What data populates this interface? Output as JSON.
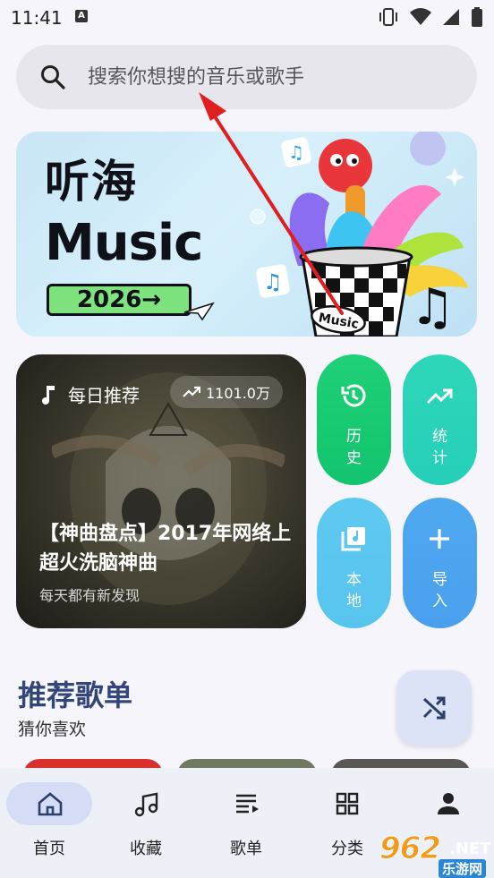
{
  "status_bar": {
    "time": "11:41",
    "notification_icon": "A"
  },
  "search": {
    "placeholder": "搜索你想搜的音乐或歌手"
  },
  "banner": {
    "title_cn": "听海",
    "title_en": "Music",
    "year_tag": "2026→",
    "bucket_label": "Music"
  },
  "daily": {
    "label": "每日推荐",
    "play_count": "1101.0万",
    "title": "【神曲盘点】2017年网络上超火洗脑神曲",
    "subtitle": "每天都有新发现"
  },
  "tiles": {
    "history": [
      "历",
      "史"
    ],
    "stats": [
      "统",
      "计"
    ],
    "local": [
      "本",
      "地"
    ],
    "import": [
      "导",
      "入"
    ]
  },
  "section": {
    "title": "推荐歌单",
    "subtitle": "猜你喜欢"
  },
  "nav": {
    "home": "首页",
    "favorites": "收藏",
    "playlists": "歌单",
    "categories": "分类",
    "me": ""
  },
  "watermark": {
    "number": "962",
    "net": ".NET",
    "sub": "乐游网"
  },
  "colors": {
    "accent": "#33467a",
    "history": "#12c46d",
    "stats": "#25cfb8",
    "local": "#58c5ef",
    "import": "#4aa0ee",
    "annotation_arrow": "#e02020"
  }
}
